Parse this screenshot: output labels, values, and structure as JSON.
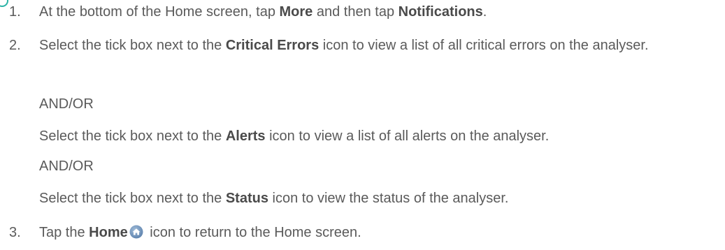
{
  "steps": [
    {
      "num": "1.",
      "pre": "At the bottom of the Home screen, tap ",
      "bold1": "More",
      "mid": " and then tap ",
      "bold2": "Notifications",
      "post": "."
    },
    {
      "num": "2.",
      "pre": "Select the tick box next to the ",
      "bold": "Critical Errors",
      "post": " icon to view a list of all critical errors on the analyser."
    },
    {
      "andor": "AND/OR"
    },
    {
      "pre": "Select the tick box next to the ",
      "bold": "Alerts",
      "post": " icon to view a list of all alerts on the analyser."
    },
    {
      "andor": "AND/OR"
    },
    {
      "pre": "Select the tick box next to the ",
      "bold": "Status",
      "post": " icon to view the status of the analyser."
    },
    {
      "num": "3.",
      "pre": "Tap the ",
      "bold": "Home",
      "post": " icon to return to the Home screen."
    }
  ],
  "icons": {
    "home": "home-icon",
    "accent_color": "#2bb3a6",
    "home_icon_color": "#7a9cc0"
  }
}
